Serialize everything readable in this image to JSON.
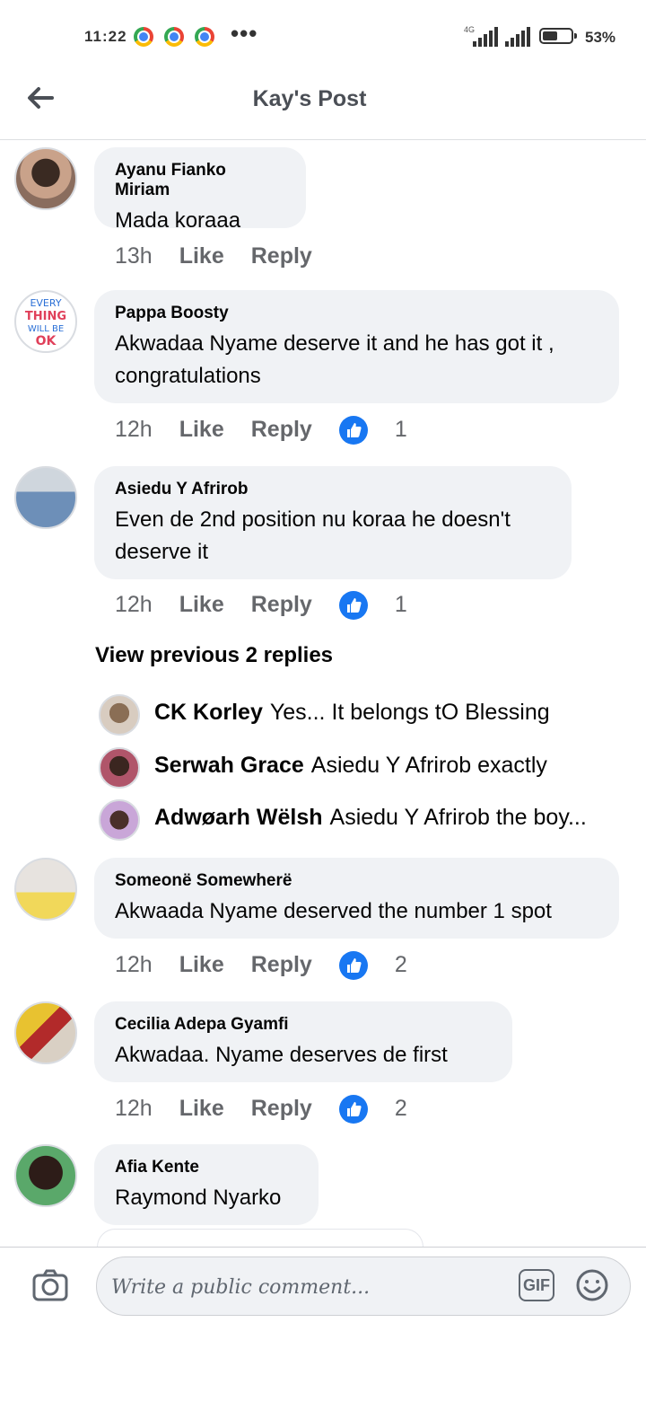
{
  "status_bar": {
    "time": "11:22",
    "network": "4G",
    "battery": "53%",
    "battery_level": 0.53
  },
  "header": {
    "title": "Kay's Post"
  },
  "comments": [
    {
      "name": "Ayanu Fianko Miriam",
      "text": "Mada koraaa",
      "time": "13h",
      "like": "Like",
      "reply": "Reply",
      "reactions": ""
    },
    {
      "name": "Pappa Boosty",
      "text": "Akwadaa Nyame deserve it and he has got it , congratulations",
      "time": "12h",
      "like": "Like",
      "reply": "Reply",
      "reactions": "1"
    },
    {
      "name": "Asiedu Y Afrirob",
      "text": "Even de 2nd position nu koraa he doesn't deserve it",
      "time": "12h",
      "like": "Like",
      "reply": "Reply",
      "reactions": "1"
    },
    {
      "name": "Someonë Somewherë",
      "text": "Akwaada Nyame deserved the number 1 spot",
      "time": "12h",
      "like": "Like",
      "reply": "Reply",
      "reactions": "2"
    },
    {
      "name": "Cecilia Adepa Gyamfi",
      "text": "Akwadaa. Nyame deserves de first",
      "time": "12h",
      "like": "Like",
      "reply": "Reply",
      "reactions": "2"
    },
    {
      "name": "Afia Kente",
      "text": "Raymond Nyarko"
    }
  ],
  "replies": {
    "view_previous": "View previous 2 replies",
    "items": [
      {
        "name": "CK  Korley",
        "text": "Yes... It belongs tO Blessing"
      },
      {
        "name": "Serwah Grace",
        "text": "Asiedu Y Afrirob exactly"
      },
      {
        "name": "Adwøarh Wëlsh",
        "text": "Asiedu Y Afrirob the boy..."
      }
    ]
  },
  "footer": {
    "placeholder": "Write a public comment...",
    "gif_label": "GIF",
    "icons": [
      "camera-icon",
      "gif-icon",
      "emoji-icon"
    ]
  },
  "colors": {
    "bubble": "#f0f2f5",
    "like_blue": "#1877f2",
    "meta_gray": "#65676b"
  }
}
